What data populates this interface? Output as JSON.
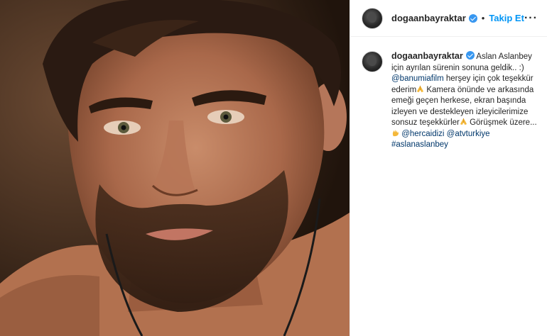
{
  "post": {
    "username": "dogaanbayraktar",
    "separator": "•",
    "follow_label": "Takip Et",
    "more_label": "···"
  },
  "caption": {
    "username": "dogaanbayraktar",
    "text_1": "Aslan Aslanbey için ayrılan sürenin sonuna geldik.. :)",
    "mention_1": "@banumiafilm",
    "text_2": "herşey için çok teşekkür ederim",
    "text_3": "Kamera önünde ve arkasında emeği geçen herkese, ekran başında izleyen ve destekleyen izleyicilerimize sonsuz teşekkürler",
    "text_4": "Görüşmek üzere...",
    "mention_2": "@hercaidizi",
    "mention_3": "@atvturkiye",
    "hashtag_1": "#aslanaslanbey"
  },
  "icons": {
    "verified": "verified-badge-icon",
    "more": "more-options-icon",
    "pray": "folded-hands-emoji",
    "wave": "waving-hand-emoji"
  },
  "colors": {
    "link": "#0095f6",
    "mention": "#00376b",
    "verified": "#3897f0"
  }
}
